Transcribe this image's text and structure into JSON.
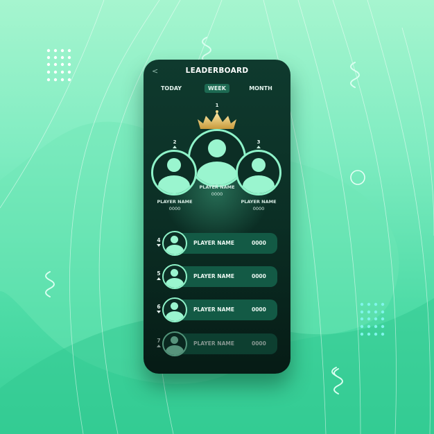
{
  "header": {
    "back_icon": "chevron-left-icon",
    "back_label": "<",
    "title": "LEADERBOARD"
  },
  "tabs": [
    {
      "label": "TODAY",
      "active": false
    },
    {
      "label": "WEEK",
      "active": true
    },
    {
      "label": "MONTH",
      "active": false
    }
  ],
  "podium": {
    "crown_icon": "crown-icon",
    "first": {
      "rank": "1",
      "name": "PLAYER NAME",
      "score": "0000"
    },
    "second": {
      "rank": "2",
      "name": "PLAYER NAME",
      "score": "0000"
    },
    "third": {
      "rank": "3",
      "name": "PLAYER NAME",
      "score": "0000"
    }
  },
  "list": [
    {
      "rank": "4",
      "trend": "down",
      "name": "PLAYER NAME",
      "score": "0000"
    },
    {
      "rank": "5",
      "trend": "up",
      "name": "PLAYER NAME",
      "score": "0000"
    },
    {
      "rank": "6",
      "trend": "down",
      "name": "PLAYER NAME",
      "score": "0000"
    },
    {
      "rank": "7",
      "trend": "up",
      "name": "PLAYER NAME",
      "score": "0000"
    }
  ],
  "colors": {
    "accent": "#8ff3c9",
    "phone_bg": "#0b2f25",
    "active_tab": "#1d6a52",
    "row_bg": "#135a45",
    "crown": "#e2c46f"
  }
}
